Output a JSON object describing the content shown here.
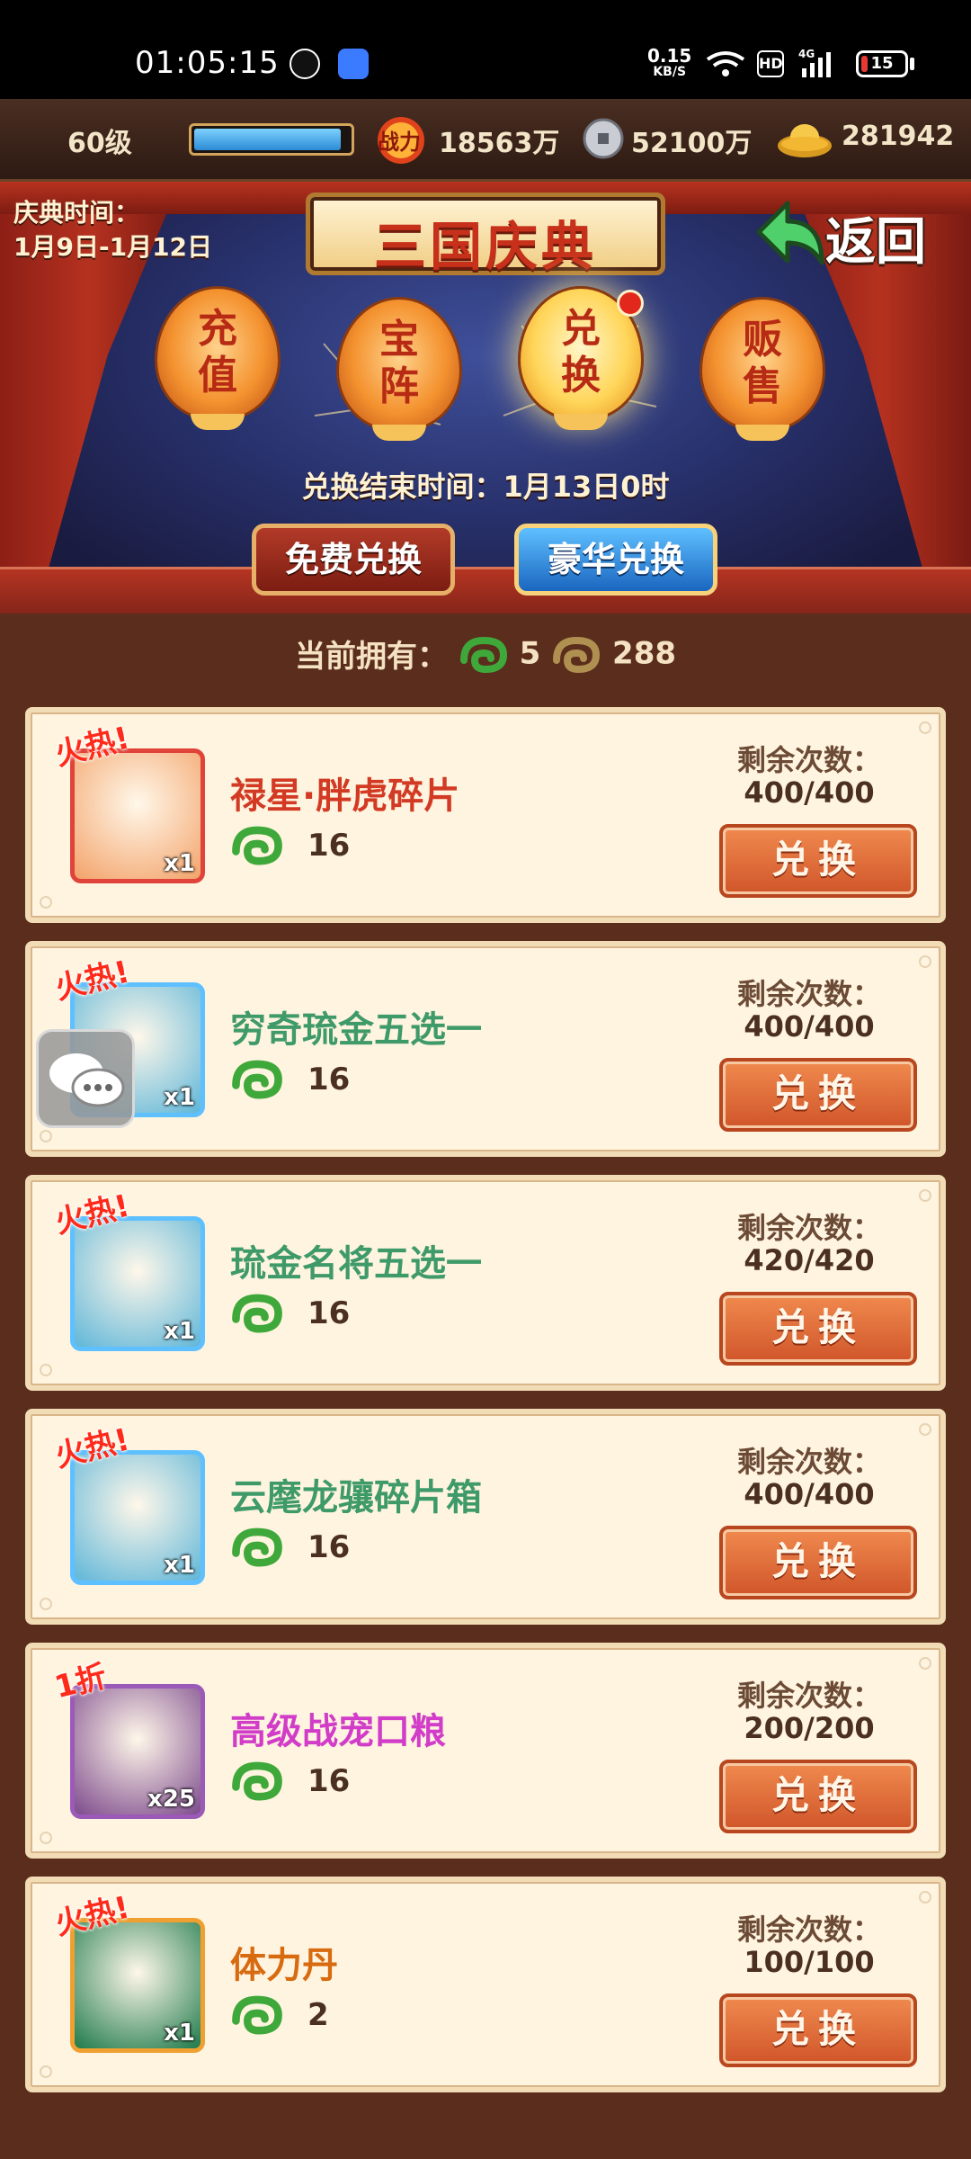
{
  "status_bar": {
    "time": "01:05:15",
    "net_speed": "0.15",
    "net_unit": "KB/S",
    "hd": "HD",
    "signal": "4G",
    "battery": "15",
    "battery_level": 0.15
  },
  "resources": {
    "level": "60级",
    "exp_progress": 0.95,
    "power_label": "战力",
    "power": "18563万",
    "silver": "52100万",
    "gold": "281942"
  },
  "banner": {
    "festival_label": "庆典时间：",
    "festival_dates": "1月9日-1月12日",
    "title": "三国庆典",
    "back": "返回",
    "lanterns": [
      {
        "label": "充值",
        "active": false
      },
      {
        "label": "宝阵",
        "active": false
      },
      {
        "label": "兑换",
        "active": true
      },
      {
        "label": "贩售",
        "active": false
      }
    ],
    "end_time": "兑换结束时间：1月13日0时",
    "tabs": {
      "free": "免费兑换",
      "luxury": "豪华兑换"
    }
  },
  "owned": {
    "label": "当前拥有：",
    "green": "5",
    "gold": "288"
  },
  "items": [
    {
      "tag": "火热!",
      "name": "禄星·胖虎碎片",
      "name_color": "#d23a24",
      "qty": "x1",
      "cost": "16",
      "remain_label": "剩余次数：",
      "remain": "400/400",
      "button": "兑换",
      "icon_bg": "#f3a36a",
      "frame": "#e0433a"
    },
    {
      "tag": "火热!",
      "name": "穷奇琉金五选一",
      "name_color": "#3f9a6a",
      "qty": "x1",
      "cost": "16",
      "remain_label": "剩余次数：",
      "remain": "400/400",
      "button": "兑换",
      "icon_bg": "#5fb6d8",
      "frame": "#5fc0ff"
    },
    {
      "tag": "火热!",
      "name": "琉金名将五选一",
      "name_color": "#3f9a6a",
      "qty": "x1",
      "cost": "16",
      "remain_label": "剩余次数：",
      "remain": "420/420",
      "button": "兑换",
      "icon_bg": "#5fb6d8",
      "frame": "#5fc0ff"
    },
    {
      "tag": "火热!",
      "name": "云麾龙骧碎片箱",
      "name_color": "#3f9a6a",
      "qty": "x1",
      "cost": "16",
      "remain_label": "剩余次数：",
      "remain": "400/400",
      "button": "兑换",
      "icon_bg": "#5fb6d8",
      "frame": "#5fc0ff"
    },
    {
      "tag": "1折",
      "name": "高级战宠口粮",
      "name_color": "#d13cc8",
      "qty": "x25",
      "cost": "16",
      "remain_label": "剩余次数：",
      "remain": "200/200",
      "button": "兑换",
      "icon_bg": "#7d4a8c",
      "frame": "#9b5ab8"
    },
    {
      "tag": "火热!",
      "name": "体力丹",
      "name_color": "#d86a10",
      "qty": "x1",
      "cost": "2",
      "remain_label": "剩余次数：",
      "remain": "100/100",
      "button": "兑换",
      "icon_bg": "#1e7a4a",
      "frame": "#f0a030"
    }
  ],
  "colors": {
    "accent": "#d0552a",
    "card_bg": "#fff4df",
    "list_bg": "#5b2d1d"
  }
}
